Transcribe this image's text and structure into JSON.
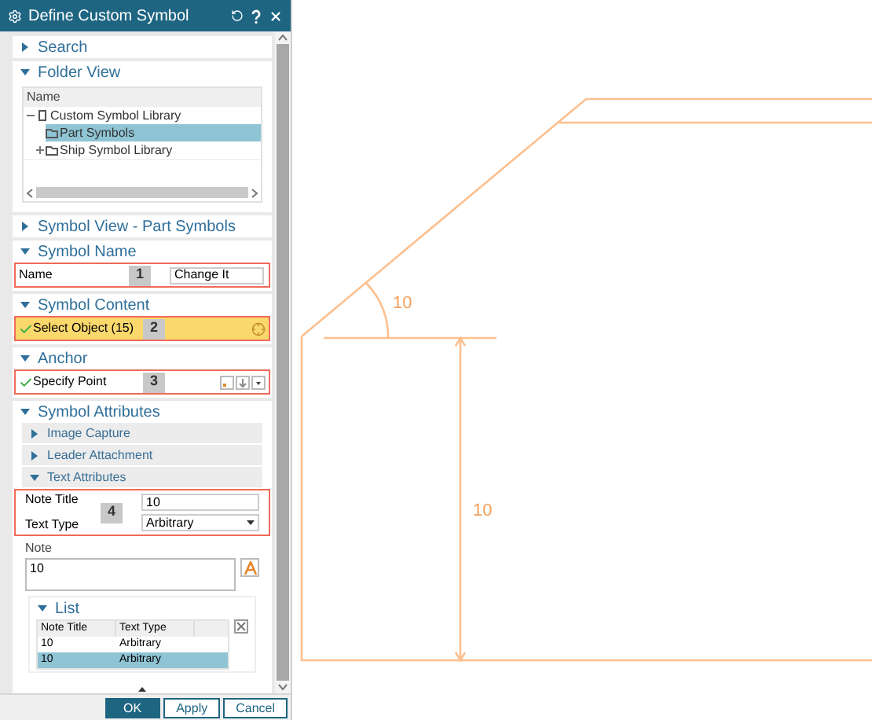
{
  "dialog_title": "Define Custom Symbol",
  "search": {
    "title": "Search",
    "expanded": false
  },
  "folder_view": {
    "title": "Folder View",
    "expanded": true,
    "column": "Name",
    "tree": [
      {
        "label": "Custom Symbol Library",
        "expanded": true,
        "selected": false,
        "children": [
          {
            "label": "Part Symbols",
            "selected": true
          },
          {
            "label": "Ship Symbol Library",
            "expanded": false,
            "selected": false
          }
        ]
      }
    ]
  },
  "symbol_view": {
    "title": "Symbol View - Part Symbols",
    "expanded": false
  },
  "symbol_name": {
    "title": "Symbol Name",
    "expanded": true,
    "label": "Name",
    "step": "1",
    "value": "Change It"
  },
  "symbol_content": {
    "title": "Symbol Content",
    "expanded": true,
    "label": "Select Object (15)",
    "done": true,
    "active": true,
    "step": "2"
  },
  "anchor": {
    "title": "Anchor",
    "expanded": true,
    "label": "Specify Point",
    "done": true,
    "active": false,
    "step": "3"
  },
  "symbol_attributes": {
    "title": "Symbol Attributes",
    "expanded": true,
    "subsections": [
      {
        "title": "Image Capture",
        "expanded": false
      },
      {
        "title": "Leader Attachment",
        "expanded": false
      },
      {
        "title": "Text Attributes",
        "expanded": true
      }
    ],
    "note_title_label": "Note Title",
    "note_title_value": "10",
    "text_type_label": "Text Type",
    "text_type_value": "Arbitrary",
    "step": "4",
    "note_label": "Note",
    "note_value": "10",
    "list": {
      "title": "List",
      "expanded": true,
      "columns": [
        "Note Title",
        "Text Type"
      ],
      "rows": [
        {
          "cells": [
            "10",
            "Arbitrary"
          ],
          "selected": false
        },
        {
          "cells": [
            "10",
            "Arbitrary"
          ],
          "selected": true
        }
      ]
    }
  },
  "buttons": [
    {
      "label": "OK",
      "primary": true
    },
    {
      "label": "Apply",
      "primary": false
    },
    {
      "label": "Cancel",
      "primary": false
    }
  ],
  "drawing": {
    "angle_label": "10",
    "height_label": "10"
  }
}
